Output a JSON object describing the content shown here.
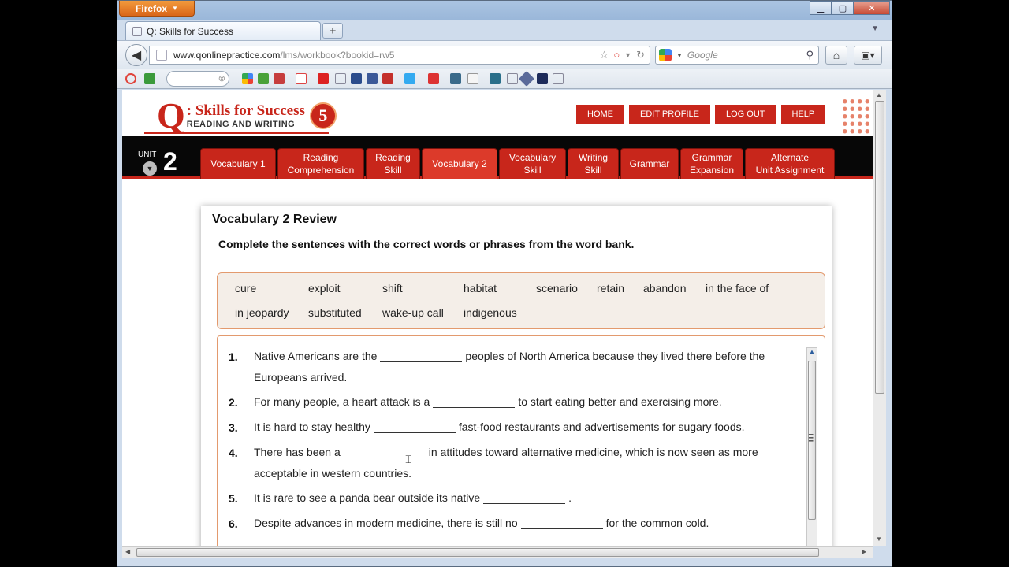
{
  "browser": {
    "app_button": "Firefox",
    "tab_title": "Q: Skills for Success",
    "url_host": "www.qonlinepractice.com",
    "url_path": "/lms/workbook?bookid=rw5",
    "search_placeholder": "Google"
  },
  "site": {
    "logo_q": "Q",
    "logo_title": ": Skills for Success",
    "logo_subtitle": "READING AND WRITING",
    "logo_level": "5",
    "nav": [
      "HOME",
      "EDIT PROFILE",
      "LOG OUT",
      "HELP"
    ],
    "brand_color": "#c8261b"
  },
  "unit": {
    "label": "UNIT",
    "number": "2",
    "tabs": [
      "Vocabulary 1",
      "Reading\nComprehension",
      "Reading\nSkill",
      "Vocabulary 2",
      "Vocabulary\nSkill",
      "Writing\nSkill",
      "Grammar",
      "Grammar\nExpansion",
      "Alternate\nUnit Assignment"
    ],
    "active_tab": "Vocabulary 2"
  },
  "exercise": {
    "title": "Vocabulary 2 Review",
    "instructions": "Complete the sentences with the correct words or phrases from the word bank.",
    "word_bank": [
      "cure",
      "exploit",
      "shift",
      "habitat",
      "scenario",
      "retain",
      "abandon",
      "in the face of",
      "in jeopardy",
      "substituted",
      "wake-up call",
      "indigenous"
    ],
    "questions": [
      {
        "num": "1.",
        "before": "Native Americans are the",
        "after": "peoples of North America because they lived there before the",
        "line2": "Europeans arrived."
      },
      {
        "num": "2.",
        "before": "For many people, a heart attack is a",
        "after": "to start eating better and exercising more."
      },
      {
        "num": "3.",
        "before": "It is hard to stay healthy",
        "after": "fast-food restaurants and advertisements for sugary foods."
      },
      {
        "num": "4.",
        "before": "There has been a",
        "after": "in attitudes toward alternative medicine, which is now seen as more",
        "line2": "acceptable in western countries."
      },
      {
        "num": "5.",
        "before": "It is rare to see a panda bear outside its native",
        "after": "."
      },
      {
        "num": "6.",
        "before": "Despite advances in modern medicine, there is still no",
        "after": "for the common cold."
      }
    ]
  }
}
